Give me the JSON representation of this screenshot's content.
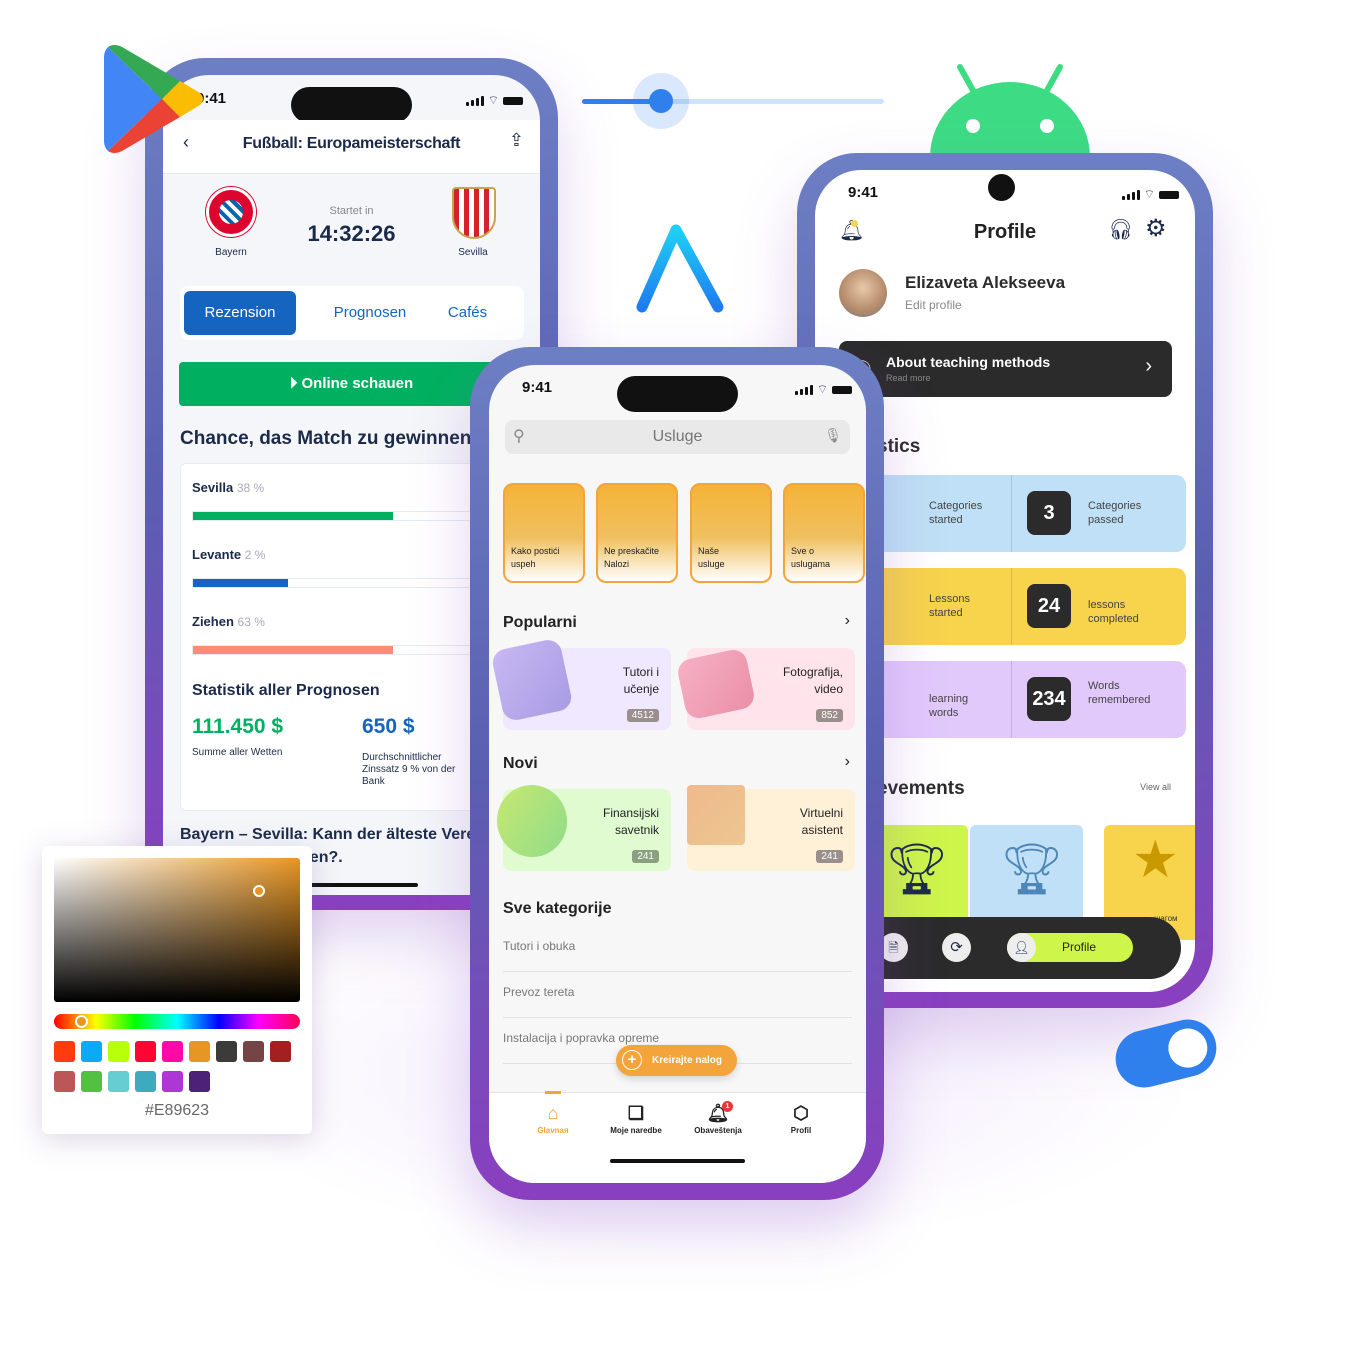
{
  "decor": {
    "slider_value": 0.26,
    "toggle_on": true,
    "icons": [
      "google-play-icon",
      "app-store-icon",
      "android-icon"
    ]
  },
  "left_phone": {
    "time": "9:41",
    "title": "Fußball: Europameisterschaft",
    "home_team": "Bayern",
    "away_team": "Sevilla",
    "starts_label": "Startet in",
    "countdown": "14:32:26",
    "tabs": [
      "Rezension",
      "Prognosen",
      "Cafés"
    ],
    "active_tab": "Rezension",
    "watch_button": "Online schauen",
    "chance_title": "Chance, das Match zu gewinnen",
    "predictions": [
      {
        "label": "Sevilla",
        "percent_text": "38 %",
        "fill": 0.67,
        "color": "#00b060"
      },
      {
        "label": "Levante",
        "percent_text": "2 %",
        "fill": 0.32,
        "color": "#1565c0"
      },
      {
        "label": "Ziehen",
        "percent_text": "63 %",
        "fill": 0.67,
        "color": "#ff8a75"
      }
    ],
    "stats_title": "Statistik aller Prognosen",
    "total_value": "111.450 $",
    "total_label": "Summe aller Wetten",
    "avg_value": "650 $",
    "avg_label": "Durchschnittlicher Zinssatz 9 % von der Bank",
    "article_title": "Bayern – Sevilla: Kann der älteste Verein das Spiel gewinnen?."
  },
  "color_picker": {
    "hex": "#E89623",
    "swatches": [
      "#ff3b0f",
      "#0aaaf5",
      "#b7ff0a",
      "#ff0533",
      "#ff0aa8",
      "#e89623",
      "#3d3a3a",
      "#754545",
      "#a41f20",
      "#bc5758",
      "#51c13f",
      "#66cdd2",
      "#3eaac0",
      "#ae35d6",
      "#4b2277"
    ]
  },
  "center_phone": {
    "time": "9:41",
    "search_placeholder": "Usluge",
    "stories": [
      "Kako postići uspeh",
      "Ne preskačite Nalozi",
      "Naše usluge",
      "Sve o uslugama"
    ],
    "popular_title": "Popularni",
    "popular": [
      {
        "title": "Tutori i učenje",
        "count": "4512",
        "bg": "#efe8ff",
        "icon": "book-icon"
      },
      {
        "title": "Fotografija, video",
        "count": "852",
        "bg": "#ffe4ec",
        "icon": "camera-icon"
      }
    ],
    "new_title": "Novi",
    "new": [
      {
        "title": "Finansijski savetnik",
        "count": "241",
        "bg": "#e0fbd0",
        "icon": "coin-icon"
      },
      {
        "title": "Virtuelni asistent",
        "count": "241",
        "bg": "#fff0d8",
        "icon": "monitor-icon"
      }
    ],
    "all_title": "Sve kategorije",
    "all": [
      "Tutori i obuka",
      "Prevoz tereta",
      "Instalacija i popravka opreme"
    ],
    "create_button": "Kreirajte nalog",
    "nav": [
      {
        "label": "Glavnaя",
        "active": true
      },
      {
        "label": "Moje naredbe"
      },
      {
        "label": "Obaveštenja",
        "badge": "1"
      },
      {
        "label": "Profil"
      }
    ],
    "accent": "#f3a43a"
  },
  "right_phone": {
    "time": "9:41",
    "title": "Profile",
    "user_name": "Elizaveta Alekseeva",
    "edit_profile": "Edit profile",
    "banner_title": "About teaching methods",
    "banner_sub": "Read more",
    "stats_title": "stics",
    "stats": [
      {
        "left_label": "Categories started",
        "value": "3",
        "right_label": "Categories passed",
        "bg": "#bfe0f6",
        "stub": "#5ea3d0"
      },
      {
        "left_label": "Lessons started",
        "value": "24",
        "right_label": "lessons completed",
        "bg": "#f7d44c",
        "stub": "#c9a300"
      },
      {
        "left_label": "learning words",
        "value": "234",
        "right_label": "Words remembered",
        "bg": "#e2c9fb",
        "stub": "#a888cc"
      }
    ],
    "achievements_title": "evements",
    "view_all": "View all",
    "achievement_partial_label": "шагом",
    "nav_active": "Profile"
  }
}
